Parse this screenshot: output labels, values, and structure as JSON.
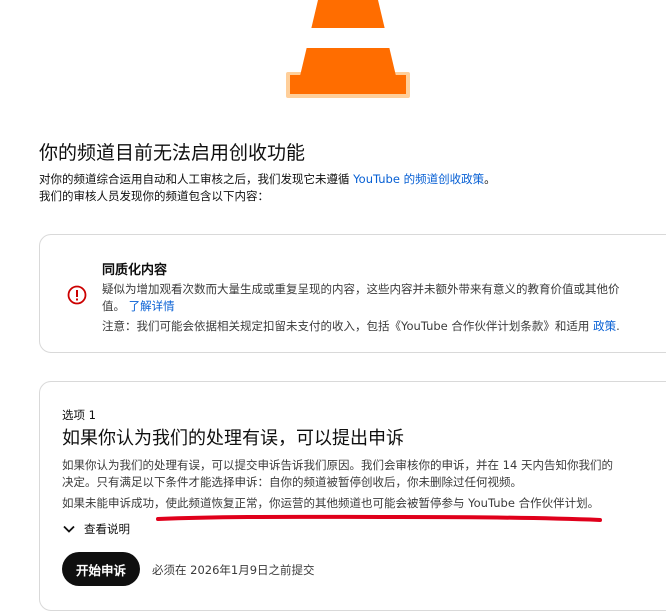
{
  "header": {
    "title": "你的频道目前无法启用创收功能",
    "intro_line1_prefix": "对你的频道综合运用自动和人工审核之后，我们发现它未遵循 ",
    "intro_link": "YouTube 的频道创收政策",
    "intro_line1_suffix": "。",
    "intro_line2": "我们的审核人员发现你的频道包含以下内容："
  },
  "issue_card": {
    "title": "同质化内容",
    "description": "疑似为增加观看次数而大量生成或重复呈现的内容，这些内容并未额外带来有意义的教育价值或其他价值。",
    "learn_more": "了解详情",
    "note_prefix": "注意：我们可能会依据相关规定扣留未支付的收入，包括《YouTube 合作伙伴计划条款》和适用 ",
    "note_link": "政策",
    "note_suffix": "."
  },
  "option_card": {
    "label": "选项 1",
    "title": "如果你认为我们的处理有误，可以提出申诉",
    "description": "如果你认为我们的处理有误，可以提交申诉告诉我们原因。我们会审核你的申诉，并在 14 天内告知你我们的决定。只有满足以下条件才能选择申诉：自你的频道被暂停创收后，你未删除过任何视频。",
    "description2": "如果未能申诉成功，使此频道恢复正常，你运营的其他频道也可能会被暂停参与 YouTube 合作伙伴计划。",
    "expand_label": "查看说明",
    "appeal_button": "开始申诉",
    "deadline": "必须在 2026年1月9日之前提交"
  },
  "icons": {
    "cone": "traffic-cone-illustration",
    "warning": "error-circle-icon",
    "chevron": "chevron-down-icon"
  },
  "colors": {
    "link": "#065fd4",
    "warning": "#cc0000",
    "annotation": "#e0001b",
    "cone_orange": "#ff6d00"
  }
}
